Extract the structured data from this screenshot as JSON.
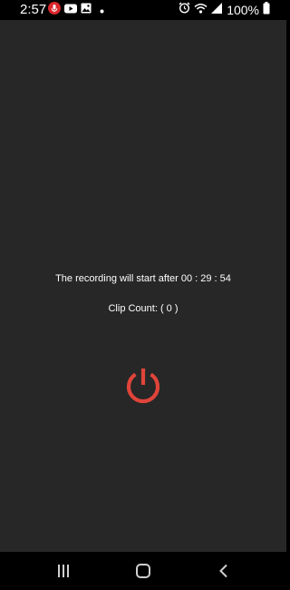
{
  "status_bar": {
    "time": "2:57",
    "battery": "100%",
    "left_icons": [
      "microphone-recording-icon",
      "youtube-icon",
      "gallery-icon",
      "dot-icon"
    ],
    "right_icons": [
      "alarm-icon",
      "wifi-icon",
      "signal-icon",
      "battery-icon"
    ]
  },
  "main": {
    "countdown_text": "The recording will start after 00 : 29 : 54",
    "clip_count_text": "Clip Count: ( 0 )",
    "power_icon": "power-icon"
  },
  "nav_bar": {
    "icons": [
      "recent-apps-icon",
      "home-icon",
      "back-icon"
    ]
  },
  "colors": {
    "background": "#272727",
    "bars": "#000000",
    "text": "#ffffff",
    "accent": "#e0443a",
    "mic_badge": "#d9262c"
  }
}
